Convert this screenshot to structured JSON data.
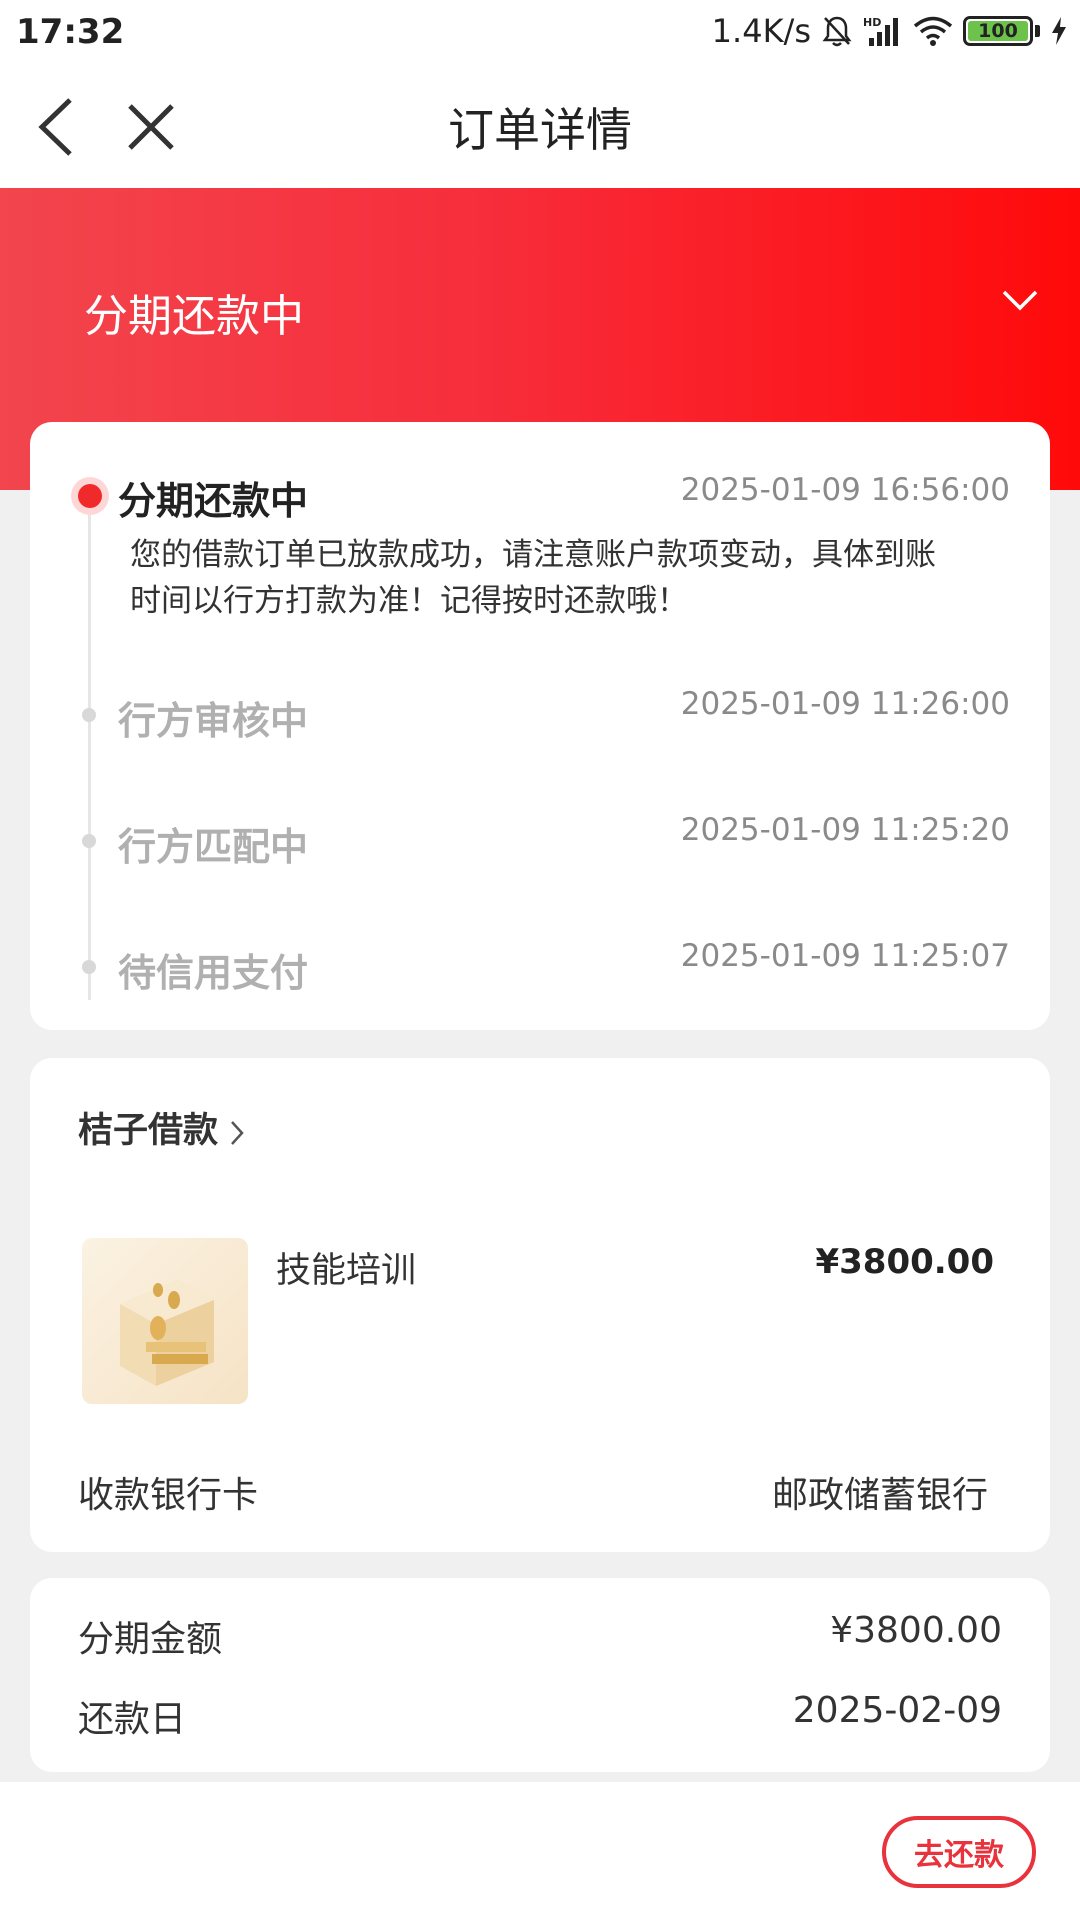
{
  "status_bar": {
    "time": "17:32",
    "net_speed": "1.4K/s",
    "network_badge": "HD",
    "battery": "100",
    "icons": [
      "mute-bell-icon",
      "signal-icon",
      "wifi-icon",
      "battery-icon",
      "charging-icon"
    ]
  },
  "nav": {
    "title": "订单详情",
    "back_icon": "chevron-left-icon",
    "close_icon": "close-icon"
  },
  "header": {
    "status_title": "分期还款中",
    "expand_icon": "chevron-down-icon",
    "gradient_start": "#f2454d",
    "gradient_end": "#ff0a0a"
  },
  "timeline": [
    {
      "label": "分期还款中",
      "time": "2025-01-09 16:56:00",
      "active": true,
      "desc_line1": "您的借款订单已放款成功，请注意账户款项变动，具体到账",
      "desc_line2": "时间以行方打款为准！记得按时还款哦！"
    },
    {
      "label": "行方审核中",
      "time": "2025-01-09 11:26:00",
      "active": false
    },
    {
      "label": "行方匹配中",
      "time": "2025-01-09 11:25:20",
      "active": false
    },
    {
      "label": "待信用支付",
      "time": "2025-01-09 11:25:07",
      "active": false
    }
  ],
  "product": {
    "shop": "桔子借款",
    "name": "技能培训",
    "price": "¥3800.00",
    "bank_label": "收款银行卡",
    "bank_value": "邮政储蓄银行"
  },
  "summary": {
    "amount_label": "分期金额",
    "amount_value": "¥3800.00",
    "due_label": "还款日",
    "due_value": "2025-02-09"
  },
  "actions": {
    "repay_button": "去还款"
  },
  "colors": {
    "accent": "#e8323c",
    "active_dot": "#f02a2a"
  }
}
